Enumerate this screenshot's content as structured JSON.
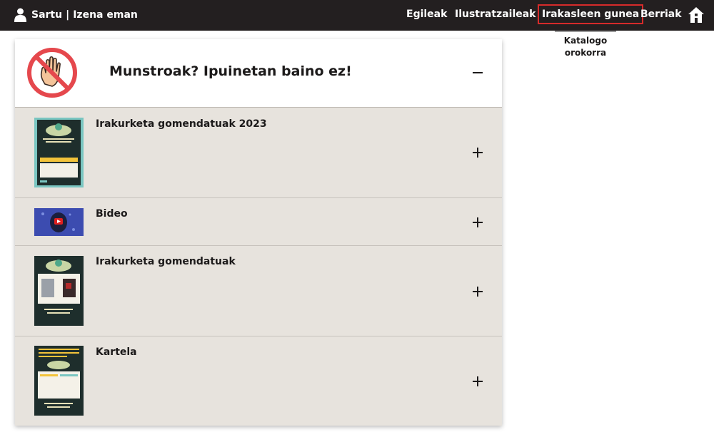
{
  "header": {
    "login_label": "Sartu",
    "separator": "|",
    "register_label": "Izena eman",
    "nav": [
      {
        "label": "Egileak",
        "active": false
      },
      {
        "label": "Ilustratzaileak",
        "active": false
      },
      {
        "label": "Irakasleen gunea",
        "active": true
      },
      {
        "label": "Berriak",
        "active": false
      }
    ],
    "home_icon": "home-icon",
    "user_icon": "user-icon",
    "active_color": "#d62b2b",
    "bar_color": "#231f20"
  },
  "submenu": {
    "label": "Katalogo orokorra"
  },
  "accordion": {
    "title": "Munstroak? Ipuinetan baino ez!",
    "icon": "no-monsters-hand-icon",
    "expanded": true,
    "items": [
      {
        "label": "Irakurketa gomendatuak 2023",
        "thumb": "poster-thumbnail"
      },
      {
        "label": "Bideo",
        "thumb": "video-thumbnail"
      },
      {
        "label": "Irakurketa gomendatuak",
        "thumb": "poster-thumbnail"
      },
      {
        "label": "Kartela",
        "thumb": "poster-thumbnail"
      }
    ],
    "panel_color": "#e7e3dd"
  }
}
